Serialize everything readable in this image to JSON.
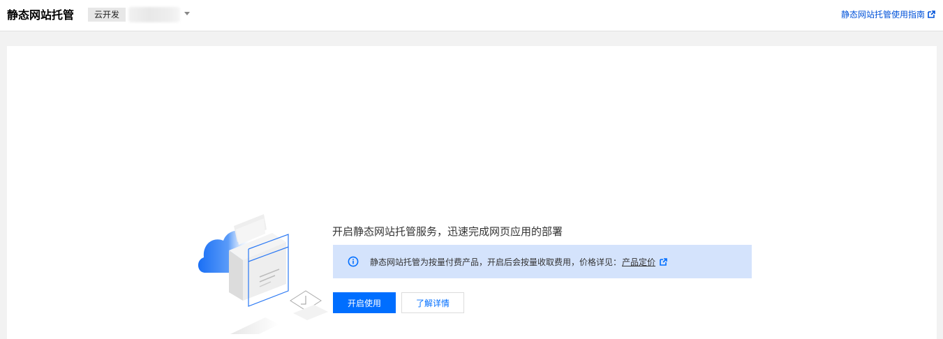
{
  "header": {
    "title": "静态网站托管",
    "env_tag": "云开发",
    "env_value": "",
    "guide_link": "静态网站托管使用指南"
  },
  "main": {
    "headline": "开启静态网站托管服务，迅速完成网页应用的部署",
    "notice": {
      "text": "静态网站托管为按量付费产品，开启后会按量收取费用，价格详见：",
      "link": "产品定价"
    },
    "primary_button": "开启使用",
    "secondary_button": "了解详情"
  },
  "colors": {
    "accent": "#006eff",
    "link": "#0052d9",
    "notice_bg": "#d4e3fc"
  },
  "icons": [
    "external-link-icon",
    "info-icon",
    "chevron-down-icon",
    "cloud-illustration"
  ]
}
